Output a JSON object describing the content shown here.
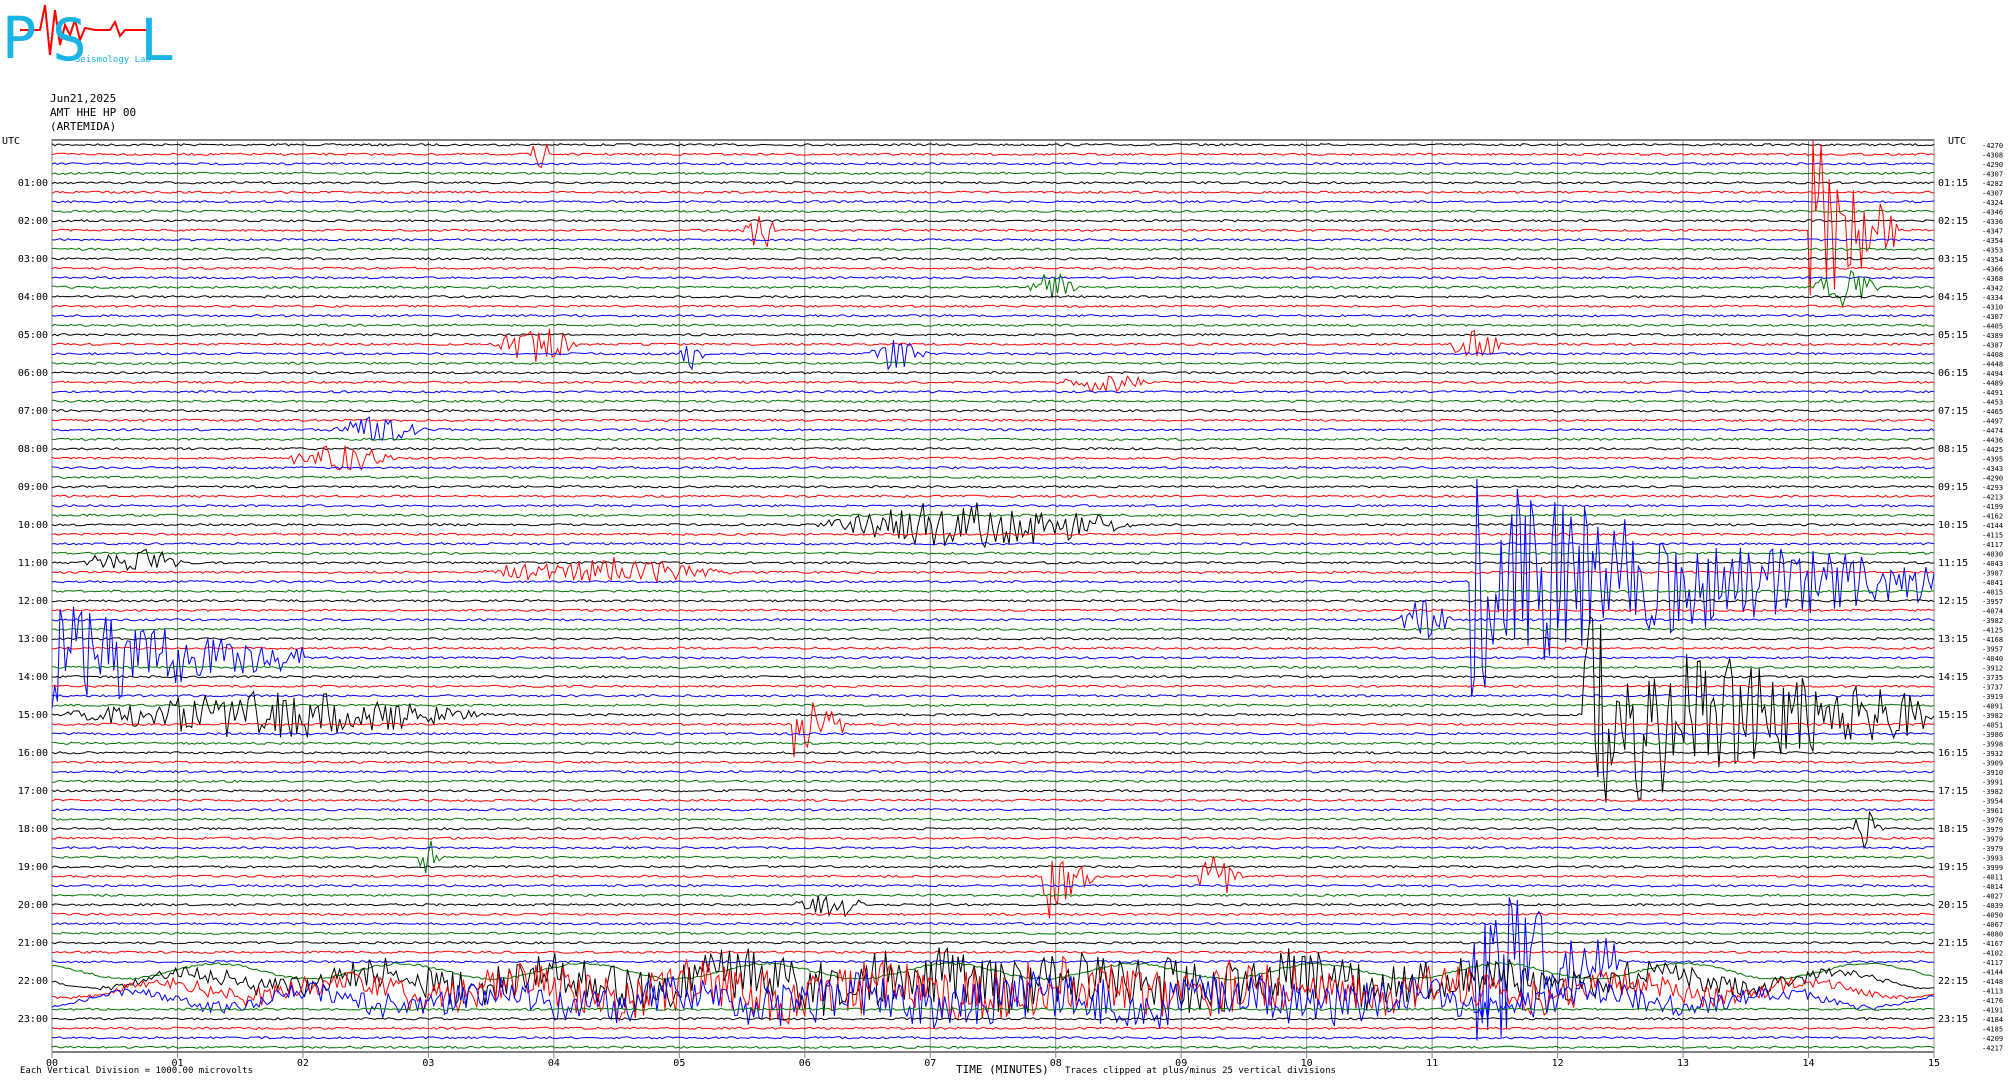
{
  "logo": {
    "letters": [
      "P",
      "S",
      "L"
    ],
    "subtitle": "Seismology Lab"
  },
  "header": {
    "date": "Jun21,2025",
    "channel": "AMT HHE HP 00",
    "station": "(ARTEMIDA)"
  },
  "footer": {
    "scale_note": "Each Vertical Division = 1000.00 microvolts",
    "xlabel": "TIME (MINUTES)",
    "clip_note": "Traces clipped at plus/minus 25 vertical divisions"
  },
  "colors": {
    "trace_cycle": [
      "#000000",
      "#ff0000",
      "#0000ff",
      "#007700"
    ]
  },
  "chart_data": {
    "type": "line",
    "title": "AMT HHE HP 00 (ARTEMIDA) Jun21,2025",
    "xlabel": "TIME (MINUTES)",
    "xlim": [
      0,
      15
    ],
    "x_ticks": [
      "00",
      "01",
      "02",
      "03",
      "04",
      "05",
      "06",
      "07",
      "08",
      "09",
      "10",
      "11",
      "12",
      "13",
      "14",
      "15"
    ],
    "left_axis_label": "UTC",
    "right_axis_label": "UTC",
    "left_hour_labels": [
      "01:00",
      "02:00",
      "03:00",
      "04:00",
      "05:00",
      "06:00",
      "07:00",
      "08:00",
      "09:00",
      "10:00",
      "11:00",
      "12:00",
      "13:00",
      "14:00",
      "15:00",
      "16:00",
      "17:00",
      "18:00",
      "19:00",
      "20:00",
      "21:00",
      "22:00",
      "23:00"
    ],
    "right_hour_labels": [
      "01:15",
      "02:15",
      "03:15",
      "04:15",
      "05:15",
      "06:15",
      "07:15",
      "08:15",
      "09:15",
      "10:15",
      "11:15",
      "12:15",
      "13:15",
      "14:15",
      "15:15",
      "16:15",
      "17:15",
      "18:15",
      "19:15",
      "20:15",
      "21:15",
      "22:15",
      "23:15"
    ],
    "trace_count": 96,
    "trace_offsets": [
      -4270,
      -4308,
      -4290,
      -4307,
      -4282,
      -4307,
      -4324,
      -4346,
      -4336,
      -4347,
      -4354,
      -4353,
      -4354,
      -4366,
      -4368,
      -4342,
      -4334,
      -4310,
      -4307,
      -4405,
      -4389,
      -4387,
      -4408,
      -4448,
      -4494,
      -4489,
      -4491,
      -4453,
      -4465,
      -4497,
      -4474,
      -4436,
      -4425,
      -4395,
      -4343,
      -4290,
      -4293,
      -4213,
      -4199,
      -4162,
      -4144,
      -4115,
      -4117,
      -4030,
      -4043,
      -3987,
      -4041,
      -4015,
      -3957,
      -4074,
      -3982,
      -4125,
      -4168,
      -3957,
      -4040,
      -3912,
      -3735,
      -3737,
      -3919,
      -4091,
      -3982,
      -4051,
      -3986,
      -3998,
      -3932,
      -3909,
      -3910,
      -3991,
      -3982,
      -3954,
      -3961,
      -3976,
      -3979,
      -3979,
      -3979,
      -3993,
      -3999,
      -4011,
      -4014,
      -4027,
      -4039,
      -4050,
      -4067,
      -4080,
      -4167,
      -4102,
      -4117,
      -4144,
      -4148,
      -4113,
      -4176,
      -4191,
      -4184,
      -4185,
      -4209,
      -4217,
      -4233
    ],
    "events": [
      {
        "trace": 1,
        "start_min": 3.8,
        "end_min": 4.0,
        "amp": 3
      },
      {
        "trace": 9,
        "start_min": 5.5,
        "end_min": 5.8,
        "amp": 4
      },
      {
        "trace": 9,
        "start_min": 14.0,
        "end_min": 14.7,
        "amp": 25
      },
      {
        "trace": 15,
        "start_min": 7.7,
        "end_min": 8.2,
        "amp": 3
      },
      {
        "trace": 15,
        "start_min": 14.0,
        "end_min": 14.6,
        "amp": 4
      },
      {
        "trace": 21,
        "start_min": 3.5,
        "end_min": 4.2,
        "amp": 4
      },
      {
        "trace": 21,
        "start_min": 11.1,
        "end_min": 11.6,
        "amp": 3
      },
      {
        "trace": 22,
        "start_min": 5.0,
        "end_min": 5.2,
        "amp": 4
      },
      {
        "trace": 22,
        "start_min": 6.5,
        "end_min": 7.0,
        "amp": 4
      },
      {
        "trace": 25,
        "start_min": 8.0,
        "end_min": 8.8,
        "amp": 2
      },
      {
        "trace": 30,
        "start_min": 2.2,
        "end_min": 3.0,
        "amp": 3
      },
      {
        "trace": 33,
        "start_min": 1.8,
        "end_min": 2.8,
        "amp": 3
      },
      {
        "trace": 40,
        "start_min": 6.0,
        "end_min": 8.7,
        "amp": 5
      },
      {
        "trace": 44,
        "start_min": 0.2,
        "end_min": 1.1,
        "amp": 3
      },
      {
        "trace": 45,
        "start_min": 3.3,
        "end_min": 5.5,
        "amp": 3
      },
      {
        "trace": 46,
        "start_min": 11.3,
        "end_min": 15.0,
        "amp": 25
      },
      {
        "trace": 50,
        "start_min": 10.7,
        "end_min": 11.2,
        "amp": 5
      },
      {
        "trace": 54,
        "start_min": 0.0,
        "end_min": 2.0,
        "amp": 14
      },
      {
        "trace": 60,
        "start_min": 0.0,
        "end_min": 3.5,
        "amp": 5
      },
      {
        "trace": 60,
        "start_min": 12.2,
        "end_min": 15.0,
        "amp": 25
      },
      {
        "trace": 61,
        "start_min": 5.9,
        "end_min": 6.3,
        "amp": 12
      },
      {
        "trace": 72,
        "start_min": 14.3,
        "end_min": 14.6,
        "amp": 4
      },
      {
        "trace": 75,
        "start_min": 2.9,
        "end_min": 3.1,
        "amp": 4
      },
      {
        "trace": 77,
        "start_min": 7.9,
        "end_min": 8.3,
        "amp": 12
      },
      {
        "trace": 77,
        "start_min": 9.1,
        "end_min": 9.5,
        "amp": 5
      },
      {
        "trace": 80,
        "start_min": 5.9,
        "end_min": 6.5,
        "amp": 3
      },
      {
        "trace": 86,
        "start_min": 11.3,
        "end_min": 12.5,
        "amp": 25
      },
      {
        "trace": 88,
        "start_min": 0.0,
        "end_min": 15.0,
        "amp": 6
      },
      {
        "trace": 89,
        "start_min": 0.0,
        "end_min": 15.0,
        "amp": 6
      },
      {
        "trace": 90,
        "start_min": 0.0,
        "end_min": 15.0,
        "amp": 5
      }
    ]
  }
}
